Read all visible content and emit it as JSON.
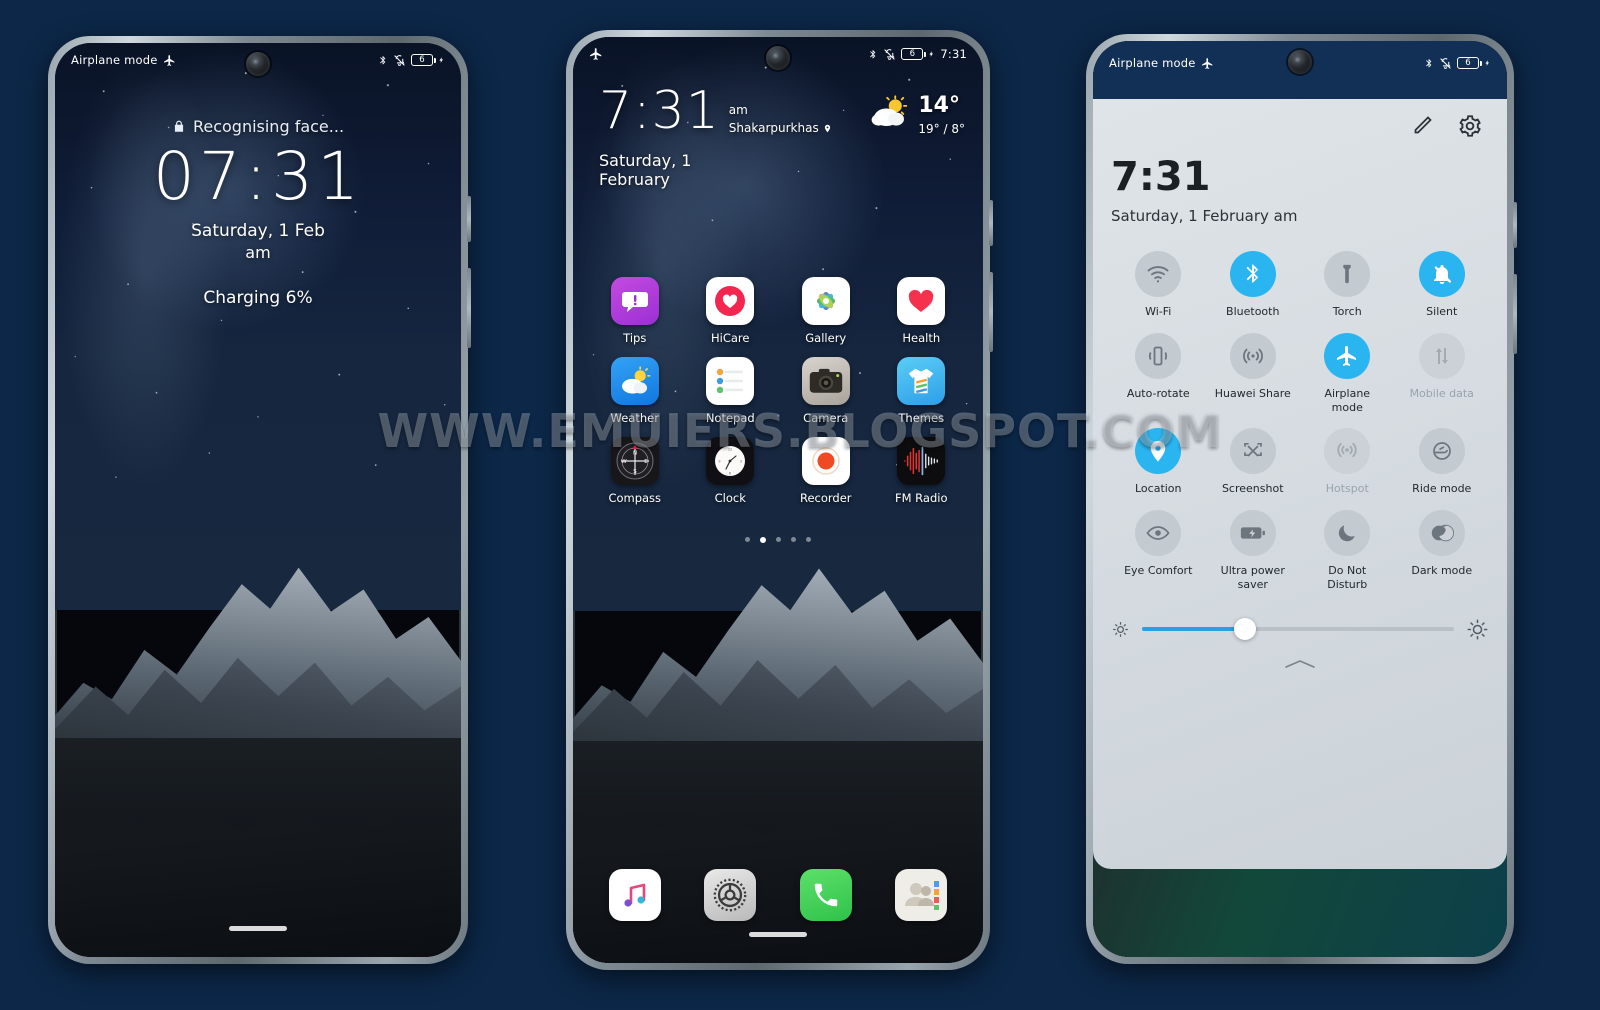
{
  "background_color": "#0c2747",
  "watermark": "WWW.EMUIERS.BLOGSPOT.COM",
  "accent_color": "#2ab4f0",
  "lock_screen": {
    "status_bar": {
      "left_text": "Airplane mode",
      "left_icon": "airplane-icon",
      "right_icons": [
        "bluetooth-icon",
        "bell-off-icon",
        "battery-icon",
        "charging-bolt-icon"
      ],
      "battery_level": "6"
    },
    "face_unlock_text": "Recognising face...",
    "lock_icon": "lock-icon",
    "time": "07:31",
    "date": "Saturday, 1 Feb",
    "meridiem": "am",
    "charging_text": "Charging 6%"
  },
  "home_screen": {
    "status_bar": {
      "left_icon": "airplane-icon",
      "right_icons": [
        "bluetooth-icon",
        "bell-off-icon",
        "battery-icon",
        "charging-bolt-icon"
      ],
      "battery_level": "6",
      "time": "7:31"
    },
    "widget": {
      "time": "7:31",
      "meridiem": "am",
      "location": "Shakarpurkhas",
      "location_icon": "location-pin-icon",
      "date": "Saturday, 1 February",
      "weather_icon": "sun-behind-cloud-icon",
      "temp_current": "14°",
      "temp_high": "19°",
      "temp_separator": "/",
      "temp_low": "8°"
    },
    "apps": [
      {
        "label": "Tips",
        "icon": "tips-icon"
      },
      {
        "label": "HiCare",
        "icon": "hicare-icon"
      },
      {
        "label": "Gallery",
        "icon": "gallery-icon"
      },
      {
        "label": "Health",
        "icon": "health-icon"
      },
      {
        "label": "Weather",
        "icon": "weather-icon"
      },
      {
        "label": "Notepad",
        "icon": "notepad-icon"
      },
      {
        "label": "Camera",
        "icon": "camera-icon"
      },
      {
        "label": "Themes",
        "icon": "themes-icon"
      },
      {
        "label": "Compass",
        "icon": "compass-icon"
      },
      {
        "label": "Clock",
        "icon": "clock-icon"
      },
      {
        "label": "Recorder",
        "icon": "recorder-icon"
      },
      {
        "label": "FM Radio",
        "icon": "fm-radio-icon"
      }
    ],
    "page_dots": {
      "count": 5,
      "active_index": 1
    },
    "dock": [
      {
        "label": "Music",
        "icon": "music-icon"
      },
      {
        "label": "Settings",
        "icon": "settings-gear-icon"
      },
      {
        "label": "Phone",
        "icon": "phone-icon"
      },
      {
        "label": "Contacts",
        "icon": "contacts-icon"
      }
    ]
  },
  "control_panel": {
    "status_bar": {
      "left_text": "Airplane mode",
      "left_icon": "airplane-icon",
      "right_icons": [
        "bluetooth-icon",
        "bell-off-icon",
        "battery-icon",
        "charging-bolt-icon"
      ],
      "battery_level": "6"
    },
    "header_icons": [
      {
        "name": "edit-pencil-icon"
      },
      {
        "name": "settings-gear-icon"
      }
    ],
    "time": "7:31",
    "date": "Saturday, 1 February  am",
    "toggles": [
      {
        "label": "Wi-Fi",
        "icon": "wifi-icon",
        "state": "off"
      },
      {
        "label": "Bluetooth",
        "icon": "bluetooth-icon",
        "state": "on"
      },
      {
        "label": "Torch",
        "icon": "torch-icon",
        "state": "off"
      },
      {
        "label": "Silent",
        "icon": "bell-off-icon",
        "state": "on"
      },
      {
        "label": "Auto-rotate",
        "icon": "auto-rotate-icon",
        "state": "off"
      },
      {
        "label": "Huawei Share",
        "icon": "huawei-share-icon",
        "state": "off"
      },
      {
        "label": "Airplane mode",
        "icon": "airplane-icon",
        "state": "on"
      },
      {
        "label": "Mobile data",
        "icon": "mobile-data-icon",
        "state": "disabled"
      },
      {
        "label": "Location",
        "icon": "location-pin-icon",
        "state": "on"
      },
      {
        "label": "Screenshot",
        "icon": "screenshot-icon",
        "state": "off"
      },
      {
        "label": "Hotspot",
        "icon": "hotspot-icon",
        "state": "disabled"
      },
      {
        "label": "Ride mode",
        "icon": "helmet-icon",
        "state": "off"
      },
      {
        "label": "Eye Comfort",
        "icon": "eye-icon",
        "state": "off"
      },
      {
        "label": "Ultra power saver",
        "icon": "battery-bolt-icon",
        "state": "off"
      },
      {
        "label": "Do Not Disturb",
        "icon": "moon-icon",
        "state": "off"
      },
      {
        "label": "Dark mode",
        "icon": "contrast-icon",
        "state": "off"
      }
    ],
    "brightness": {
      "value_percent": 33,
      "low_icon": "brightness-low-icon",
      "high_icon": "brightness-high-icon"
    },
    "expand_icon": "chevron-up-icon"
  }
}
